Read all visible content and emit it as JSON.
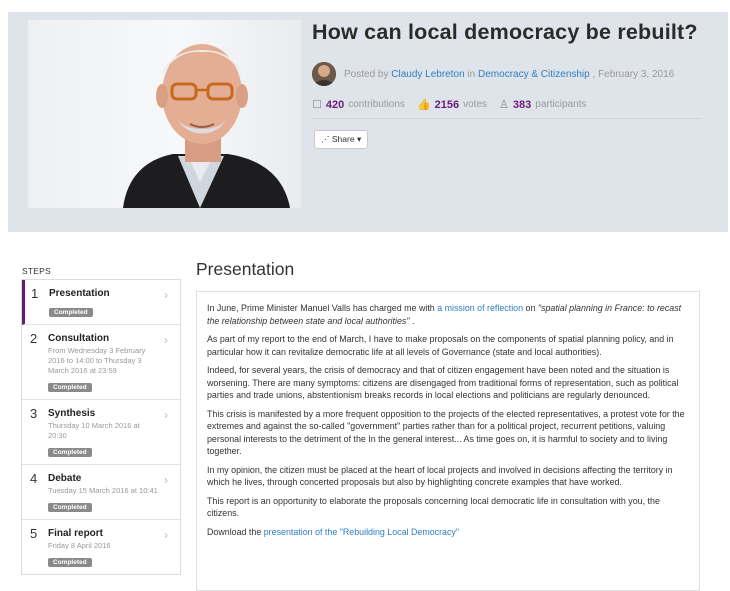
{
  "header": {
    "title": "How can local democracy be rebuilt?",
    "posted_by_prefix": "Posted by",
    "author": "Claudy Lebreton",
    "in_word": "in",
    "category": "Democracy & Citizenship",
    "date": ", February 3, 2016",
    "contributions_count": "420",
    "contributions_label": "contributions",
    "votes_count": "2156",
    "votes_label": "votes",
    "participants_count": "383",
    "participants_label": "participants",
    "share_label": "Share",
    "share_caret": "▾"
  },
  "steps": {
    "heading": "STEPS",
    "items": [
      {
        "num": "1",
        "name": "Presentation",
        "date": "",
        "badge": "Completed"
      },
      {
        "num": "2",
        "name": "Consultation",
        "date": "From Wednesday 3 February 2016 to 14:00 to Thursday 3 March 2016 at 23:59",
        "badge": "Completed"
      },
      {
        "num": "3",
        "name": "Synthesis",
        "date": "Thursday 10 March 2016 at 20:30",
        "badge": "Completed"
      },
      {
        "num": "4",
        "name": "Debate",
        "date": "Tuesday 15 March 2016 at 10:41",
        "badge": "Completed"
      },
      {
        "num": "5",
        "name": "Final report",
        "date": "Friday 8 April 2016",
        "badge": "Completed"
      }
    ],
    "chevron": "›"
  },
  "presentation": {
    "heading": "Presentation",
    "p1_a": "In June, Prime Minister Manuel Valls has charged me with ",
    "p1_link": "a mission of reflection",
    "p1_b": " on ",
    "p1_c": "\"spatial planning in France: to recast the relationship between state and local authorities\"",
    "p1_d": " .",
    "p2": "As part of my report to the end of March, I have to make proposals on the components of spatial planning policy, and in particular how it can revitalize democratic life at all levels of Governance (state and local authorities).",
    "p3": "Indeed, for several years, the crisis of democracy and that of citizen engagement have been noted and the situation is worsening. There are many symptoms: citizens are disengaged from traditional forms of representation, such as political parties and trade unions, abstentionism breaks records in local elections and politicians are regularly denounced.",
    "p4": "This crisis is manifested by a more frequent opposition to the projects of the elected representatives, a protest vote for the extremes and against the so-called \"government\" parties rather than for a political project, recurrent petitions, valuing personal interests to the detriment of the In the general interest... As time goes on, it is harmful to society and to living together.",
    "p5": "In my opinion, the citizen must be placed at the heart of local projects and involved in decisions affecting the territory in which he lives, through concerted proposals but also by highlighting concrete examples that have worked.",
    "p6": "This report is an opportunity to elaborate the proposals concerning local democratic life in consultation with you, the citizens.",
    "p7_a": "Download the ",
    "p7_link": "presentation of the \"Rebuilding Local Democracy\""
  },
  "colors": {
    "accent": "#6a1b7a",
    "link": "#2f7ec0",
    "badge": "#8a8a8a",
    "hero_bg": "#dfe4ea"
  },
  "icons": [
    "contributions-icon",
    "votes-icon",
    "participants-icon",
    "share-icon",
    "chevron-right-icon"
  ]
}
